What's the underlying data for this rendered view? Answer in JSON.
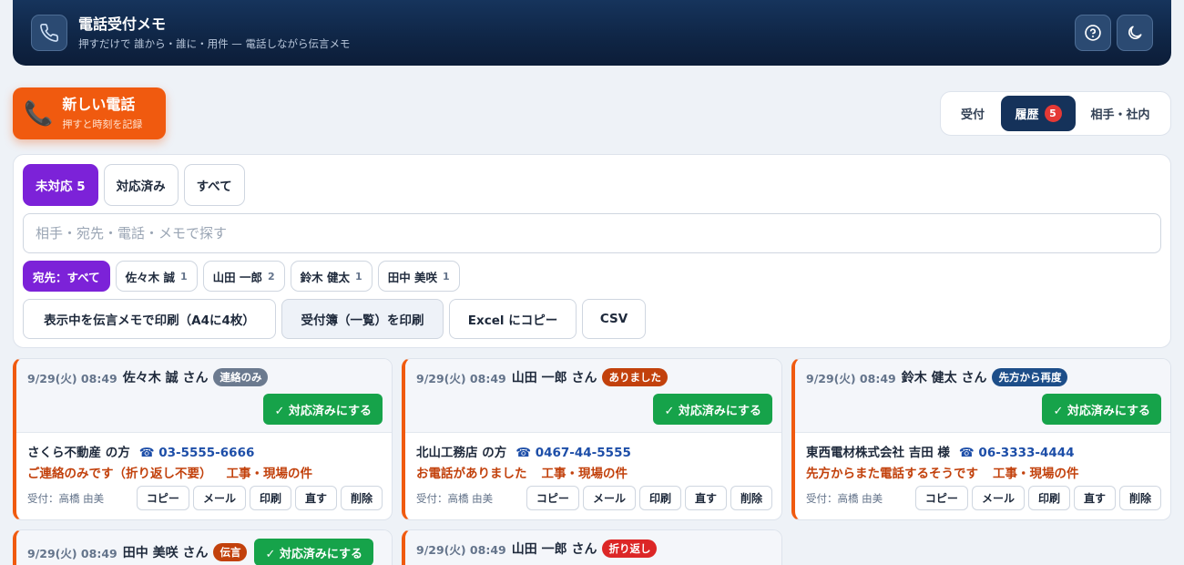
{
  "header": {
    "title": "電話受付メモ",
    "subtitle": "押すだけで 誰から・誰に・用件 — 電話しながら伝言メモ",
    "phone_icon": "phone-icon",
    "help_icon": "help-icon",
    "theme_icon": "moon-icon"
  },
  "new_call": {
    "title": "新しい電話",
    "subtitle": "押すと時刻を記録",
    "icon": "📞"
  },
  "view_tabs": {
    "reception": "受付",
    "history": "履歴",
    "history_badge": "5",
    "contacts": "相手・社内"
  },
  "filters": {
    "pending": "未対応 5",
    "done": "対応済み",
    "all": "すべて"
  },
  "search": {
    "placeholder": "相手・宛先・電話・メモで探す"
  },
  "recipient_chips": [
    {
      "label": "宛先：すべて",
      "count": ""
    },
    {
      "label": "佐々木 誠",
      "count": "1"
    },
    {
      "label": "山田 一郎",
      "count": "2"
    },
    {
      "label": "鈴木 健太",
      "count": "1"
    },
    {
      "label": "田中 美咲",
      "count": "1"
    }
  ],
  "actions": {
    "print_memo": "表示中を伝言メモで印刷（A4に4枚）",
    "print_book": "受付簿（一覧）を印刷",
    "excel": "Excel にコピー",
    "csv": "CSV"
  },
  "colors": {
    "accent": "#f05a0f",
    "purple": "#7c22d8",
    "navy": "#15325a",
    "green": "#16a34a"
  },
  "card_labels": {
    "done": "✓ 対応済みにする",
    "copy": "コピー",
    "mail": "メール",
    "print": "印刷",
    "edit": "直す",
    "delete": "削除"
  },
  "cards": [
    {
      "time": "9/29(火) 08:49",
      "to": "佐々木 誠 さん",
      "tag": "連絡のみ",
      "tag_color": "#6b7a8f",
      "from": "さくら不動産 の方",
      "tel": "☎ 03-5555-6666",
      "message": "ご連絡のみです（折り返し不要）",
      "topic": "工事・現場の件",
      "received": "受付：高橋 由美"
    },
    {
      "time": "9/29(火) 08:49",
      "to": "山田 一郎 さん",
      "tag": "ありました",
      "tag_color": "#c2410c",
      "from": "北山工務店 の方",
      "tel": "☎ 0467-44-5555",
      "message": "お電話がありました",
      "topic": "工事・現場の件",
      "received": "受付：高橋 由美"
    },
    {
      "time": "9/29(火) 08:49",
      "to": "鈴木 健太 さん",
      "tag": "先方から再度",
      "tag_color": "#1d4e89",
      "from": "東西電材株式会社 吉田 様",
      "tel": "☎ 06-3333-4444",
      "message": "先方からまた電話するそうです",
      "topic": "工事・現場の件",
      "received": "受付：高橋 由美"
    },
    {
      "time": "9/29(火) 08:49",
      "to": "田中 美咲 さん",
      "tag": "伝言",
      "tag_color": "#c2410c"
    },
    {
      "time": "9/29(火) 08:49",
      "to": "山田 一郎 さん",
      "tag": "折り返し",
      "tag_color": "#dc2626"
    }
  ]
}
